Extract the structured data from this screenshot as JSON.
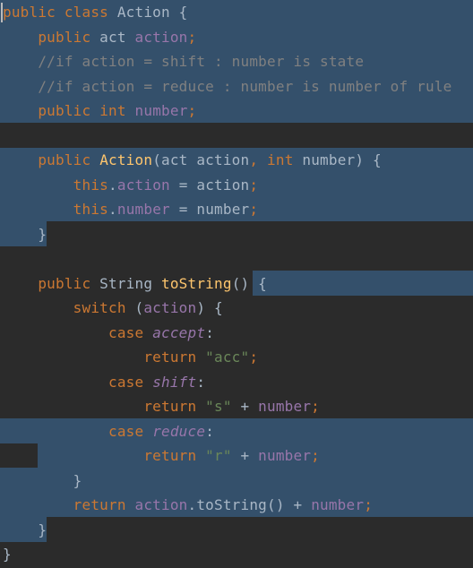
{
  "editor": {
    "language": "java",
    "colors": {
      "background": "#2b2b2b",
      "selection": "#34506b",
      "keyword": "#cc7832",
      "field": "#9876aa",
      "method": "#ffc66d",
      "comment": "#808080",
      "string": "#6a8759",
      "text": "#a9b7c6"
    },
    "lines": [
      {
        "tokens": [
          {
            "t": "public",
            "c": "kw"
          },
          {
            "t": " "
          },
          {
            "t": "class",
            "c": "kw"
          },
          {
            "t": " Action {"
          }
        ]
      },
      {
        "tokens": [
          {
            "t": "    "
          },
          {
            "t": "public",
            "c": "kw"
          },
          {
            "t": " act "
          },
          {
            "t": "action",
            "c": "fld"
          },
          {
            "t": ";",
            "c": "punc"
          }
        ]
      },
      {
        "tokens": [
          {
            "t": "    "
          },
          {
            "t": "//if action = shift : number is state",
            "c": "cmt"
          }
        ]
      },
      {
        "tokens": [
          {
            "t": "    "
          },
          {
            "t": "//if action = reduce : number is number of rule",
            "c": "cmt"
          }
        ]
      },
      {
        "tokens": [
          {
            "t": "    "
          },
          {
            "t": "public",
            "c": "kw"
          },
          {
            "t": " "
          },
          {
            "t": "int",
            "c": "kw"
          },
          {
            "t": " "
          },
          {
            "t": "number",
            "c": "fld"
          },
          {
            "t": ";",
            "c": "punc"
          }
        ]
      },
      {
        "tokens": []
      },
      {
        "tokens": [
          {
            "t": "    "
          },
          {
            "t": "public",
            "c": "kw"
          },
          {
            "t": " "
          },
          {
            "t": "Action",
            "c": "fn"
          },
          {
            "t": "(act action"
          },
          {
            "t": ",",
            "c": "punc"
          },
          {
            "t": " "
          },
          {
            "t": "int",
            "c": "kw"
          },
          {
            "t": " number) {"
          }
        ]
      },
      {
        "tokens": [
          {
            "t": "        "
          },
          {
            "t": "this",
            "c": "kw"
          },
          {
            "t": "."
          },
          {
            "t": "action",
            "c": "fld"
          },
          {
            "t": " = action"
          },
          {
            "t": ";",
            "c": "punc"
          }
        ]
      },
      {
        "tokens": [
          {
            "t": "        "
          },
          {
            "t": "this",
            "c": "kw"
          },
          {
            "t": "."
          },
          {
            "t": "number",
            "c": "fld"
          },
          {
            "t": " = number"
          },
          {
            "t": ";",
            "c": "punc"
          }
        ]
      },
      {
        "tokens": [
          {
            "t": "    }"
          }
        ]
      },
      {
        "tokens": []
      },
      {
        "tokens": [
          {
            "t": "    "
          },
          {
            "t": "public",
            "c": "kw"
          },
          {
            "t": " String "
          },
          {
            "t": "toString",
            "c": "fn"
          },
          {
            "t": "() {"
          }
        ]
      },
      {
        "tokens": [
          {
            "t": "        "
          },
          {
            "t": "switch",
            "c": "kw"
          },
          {
            "t": " ("
          },
          {
            "t": "action",
            "c": "fld"
          },
          {
            "t": ") {"
          }
        ]
      },
      {
        "tokens": [
          {
            "t": "            "
          },
          {
            "t": "case",
            "c": "kw"
          },
          {
            "t": " "
          },
          {
            "t": "accept",
            "c": "enm"
          },
          {
            "t": ":"
          }
        ]
      },
      {
        "tokens": [
          {
            "t": "                "
          },
          {
            "t": "return",
            "c": "kw"
          },
          {
            "t": " "
          },
          {
            "t": "\"acc\"",
            "c": "str"
          },
          {
            "t": ";",
            "c": "punc"
          }
        ]
      },
      {
        "tokens": [
          {
            "t": "            "
          },
          {
            "t": "case",
            "c": "kw"
          },
          {
            "t": " "
          },
          {
            "t": "shift",
            "c": "enm"
          },
          {
            "t": ":"
          }
        ]
      },
      {
        "tokens": [
          {
            "t": "                "
          },
          {
            "t": "return",
            "c": "kw"
          },
          {
            "t": " "
          },
          {
            "t": "\"s\"",
            "c": "str"
          },
          {
            "t": " + "
          },
          {
            "t": "number",
            "c": "fld"
          },
          {
            "t": ";",
            "c": "punc"
          }
        ]
      },
      {
        "tokens": [
          {
            "t": "            "
          },
          {
            "t": "case",
            "c": "kw"
          },
          {
            "t": " "
          },
          {
            "t": "reduce",
            "c": "enm"
          },
          {
            "t": ":"
          }
        ]
      },
      {
        "tokens": [
          {
            "t": "                "
          },
          {
            "t": "return",
            "c": "kw"
          },
          {
            "t": " "
          },
          {
            "t": "\"r\"",
            "c": "str"
          },
          {
            "t": " + "
          },
          {
            "t": "number",
            "c": "fld"
          },
          {
            "t": ";",
            "c": "punc"
          }
        ]
      },
      {
        "tokens": [
          {
            "t": "        }"
          }
        ]
      },
      {
        "tokens": [
          {
            "t": "        "
          },
          {
            "t": "return",
            "c": "kw"
          },
          {
            "t": " "
          },
          {
            "t": "action",
            "c": "fld"
          },
          {
            "t": ".toString() + "
          },
          {
            "t": "number",
            "c": "fld"
          },
          {
            "t": ";",
            "c": "punc"
          }
        ]
      },
      {
        "tokens": [
          {
            "t": "    }"
          }
        ]
      },
      {
        "tokens": [
          {
            "t": "}"
          }
        ]
      }
    ]
  }
}
